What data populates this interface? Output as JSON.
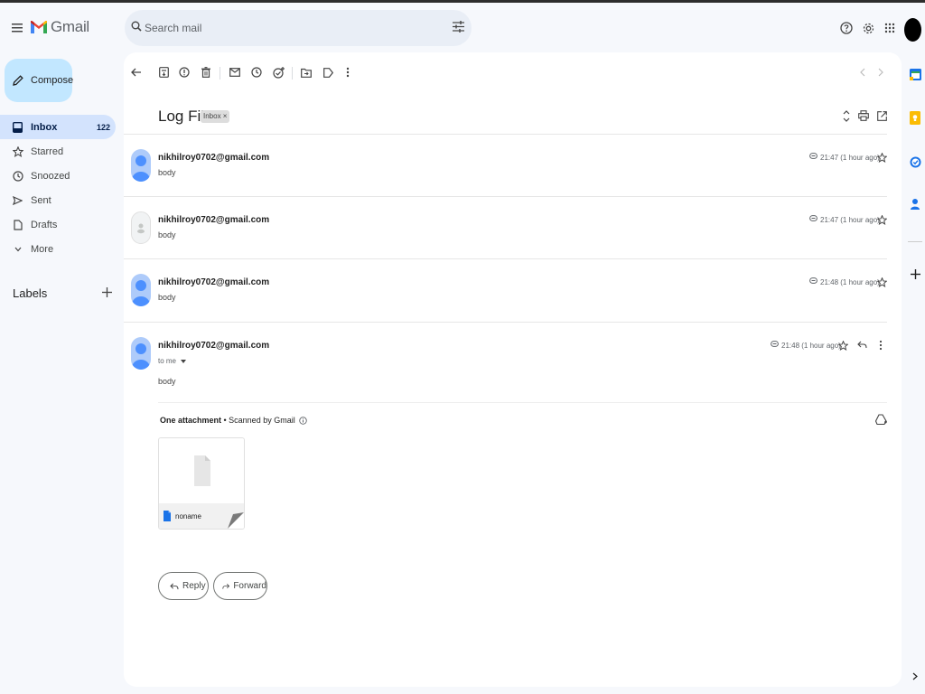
{
  "app": {
    "name": "Gmail"
  },
  "search": {
    "placeholder": "Search mail"
  },
  "sidebar": {
    "compose_label": "Compose",
    "items": [
      {
        "label": "Inbox",
        "count": "122",
        "icon": "inbox-icon",
        "active": true
      },
      {
        "label": "Starred",
        "count": "",
        "icon": "star-icon"
      },
      {
        "label": "Snoozed",
        "count": "",
        "icon": "clock-icon"
      },
      {
        "label": "Sent",
        "count": "",
        "icon": "send-icon"
      },
      {
        "label": "Drafts",
        "count": "",
        "icon": "draft-icon"
      },
      {
        "label": "More",
        "count": "",
        "icon": "chevron-down-icon"
      }
    ],
    "labels_header": "Labels"
  },
  "thread": {
    "subject": "Log File",
    "label_chip": "Inbox ×",
    "messages": [
      {
        "from": "nikhilroy0702@gmail.com",
        "snippet": "body",
        "time": "21:47 (1 hour ago)",
        "avatar": "blue"
      },
      {
        "from": "nikhilroy0702@gmail.com",
        "snippet": "body",
        "time": "21:47 (1 hour ago)",
        "avatar": "gray"
      },
      {
        "from": "nikhilroy0702@gmail.com",
        "snippet": "body",
        "time": "21:48 (1 hour ago)",
        "avatar": "blue"
      },
      {
        "from": "nikhilroy0702@gmail.com",
        "recipient": "to me",
        "body": "body",
        "time": "21:48 (1 hour ago)",
        "avatar": "blue",
        "expanded": true
      }
    ],
    "attachment": {
      "title": "One attachment",
      "scanned": " • Scanned by Gmail",
      "file_name": "noname"
    },
    "reply_label": "Reply",
    "forward_label": "Forward"
  },
  "colors": {
    "accent": "#0b57d0",
    "avatar_blue": "#4d90fe",
    "compose_bg": "#c2e7ff",
    "active_nav": "#d3e3fd"
  }
}
